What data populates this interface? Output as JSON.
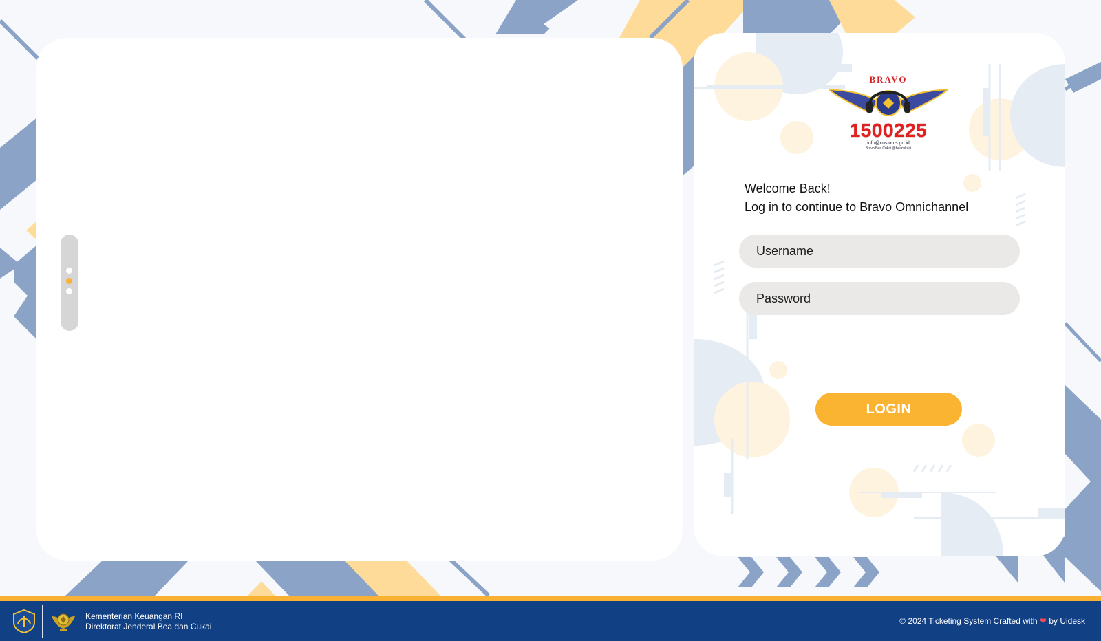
{
  "colors": {
    "accent": "#fbb332",
    "footer_bg": "#124084",
    "input_bg": "#eae9e7",
    "deco_blue": "#8aa3c6",
    "deco_yellow": "#fedb98"
  },
  "carousel": {
    "dots": 3,
    "active_index": 1
  },
  "logo": {
    "brand_text": "BRAVO",
    "hotline": "1500225",
    "email": "info@customs.go.id",
    "social": "Bravo Bea Cukai  @beacukairi"
  },
  "login": {
    "welcome_title": "Welcome Back!",
    "welcome_subtitle": "Log in to continue to Bravo Omnichannel",
    "username_placeholder": "Username",
    "password_placeholder": "Password",
    "button_label": "LOGIN"
  },
  "footer": {
    "ministry_line1": "Kementerian Keuangan RI",
    "ministry_line2": "Direktorat Jenderal Bea dan Cukai",
    "credit_prefix": "© 2024 Ticketing System Crafted with",
    "credit_icon": "heart-icon",
    "credit_suffix": "by Uidesk"
  }
}
